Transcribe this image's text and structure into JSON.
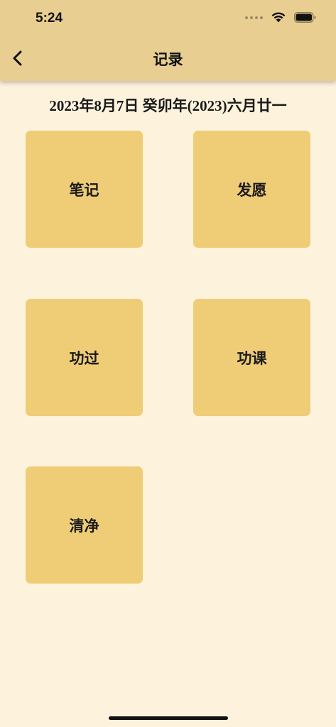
{
  "status_bar": {
    "time": "5:24",
    "icons": [
      "signal-dots-icon",
      "wifi-icon",
      "battery-icon"
    ]
  },
  "nav": {
    "back_icon": "chevron-left-icon",
    "title": "记录"
  },
  "date_line": "2023年8月7日  癸卯年(2023)六月廿一",
  "tiles": [
    {
      "label": "笔记"
    },
    {
      "label": "发愿"
    },
    {
      "label": "功过"
    },
    {
      "label": "功课"
    },
    {
      "label": "清净"
    }
  ],
  "colors": {
    "background": "#FDF2DC",
    "header": "#E8CF91",
    "tile": "#EFCC76",
    "text": "#1a1a1a"
  }
}
